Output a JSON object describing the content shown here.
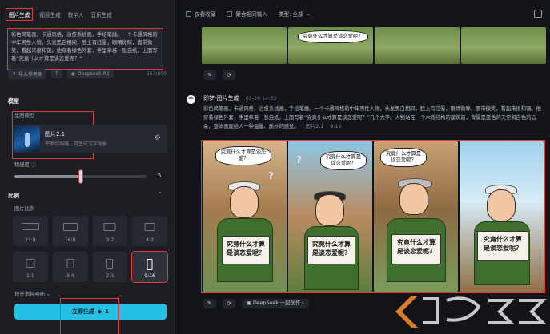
{
  "tabs": [
    "图片生成",
    "视频生成",
    "数字人",
    "音乐生成"
  ],
  "prompt": {
    "text": "彩色简笔画，卡通风格，治愈系插画，手绘笔触。一个卡通风格的中年男性人物，头发黑白相间，脸上有红晕，眼睛微眯，面带微笑，看起来很和蔼。他穿着绿色外套，手里拿着一张白纸，上面写着“究竟什么才算是谈恋爱呢？”",
    "upload_label": "导入参考图",
    "model_chip": "Deepseek-R1",
    "char_count": "153/800"
  },
  "model": {
    "section": "模型",
    "sub": "生图模型",
    "name": "图片2.1",
    "desc": "平面绘画强，可生成文字海报"
  },
  "detail": {
    "label": "精细度",
    "value": "5",
    "level": 0.5
  },
  "ratio": {
    "section": "比例",
    "sub": "图片比例",
    "options": [
      "21:9",
      "16:9",
      "3:2",
      "4:3",
      "1:1",
      "3:4",
      "2:3",
      "9:16"
    ],
    "selected": "9:16"
  },
  "credit_label": "积分消耗明细",
  "generate": {
    "label": "立即生成",
    "cost": "1"
  },
  "topbar": {
    "fav": "仅看收藏",
    "merge": "聚合相同输入",
    "type": "类型: 全部"
  },
  "history": {
    "title": "即梦-图片生成",
    "time": "03-26 14:33",
    "desc": "彩色简笔画，卡通风格，治愈系插画，手绘笔触。一个卡通风格的中年男性人物，头发黑白相间，脸上有红晕，眼睛微眯，面带微笑，看起来很和蔼。他穿着绿色外套，手里拿着一张白纸，上面写着“究竟什么才算是谈恋爱呢？”几个大字。人物站在一个木质结构的建筑前，背景是蓝色的天空和白色的云朵，整体画面给人一种温馨、质朴的感觉。",
    "model_meta": "图片2.1",
    "ratio_meta": "9:16",
    "top_bubble": "究竟什么才算是谈恋爱呢？",
    "deepseek_chip": "DeepSeek 一起创作"
  },
  "panels": [
    {
      "bubble": "究竟什么才算是谈恋爱？",
      "sign": "究竟什么才算是谈恋爱呢？"
    },
    {
      "bubble": "究竟什么才算是谈恋爱呢？",
      "sign": "究竟什么才算是谈恋爱呢？"
    },
    {
      "bubble": "究竟什么才算是谈恋爱呢？",
      "sign": "究竟什么才算是谈恋爱呢？"
    },
    {
      "bubble": "",
      "sign": "究竟什么才算是谈恋爱呢？"
    }
  ],
  "colors": {
    "accent": "#25c0e3",
    "highlight": "#e23a3a",
    "bg": "#15171c"
  }
}
